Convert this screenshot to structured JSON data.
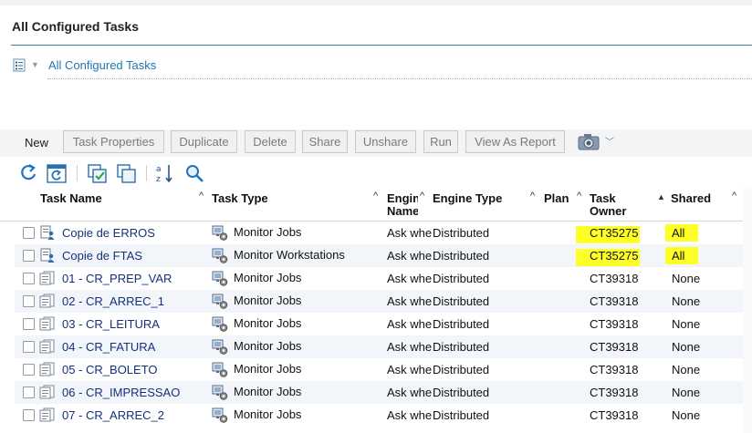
{
  "page": {
    "title": "All Configured Tasks"
  },
  "view": {
    "link": "All Configured Tasks"
  },
  "toolbar": {
    "new": "New",
    "buttons": [
      "Task Properties",
      "Duplicate",
      "Delete",
      "Share",
      "Unshare",
      "Run",
      "View As Report"
    ]
  },
  "columns": {
    "task_name": "Task Name",
    "task_type": "Task Type",
    "engine_name": "Engine Name",
    "engine_type": "Engine Type",
    "plan": "Plan",
    "task_owner": "Task Owner",
    "shared": "Shared"
  },
  "rows": [
    {
      "name": "Copie de ERROS",
      "type": "Monitor Jobs",
      "engine_name": "Ask when needed",
      "engine_type": "Distributed",
      "owner": "CT35275",
      "shared": "All",
      "highlight": true,
      "icon": "shared-task-icon"
    },
    {
      "name": "Copie de FTAS",
      "type": "Monitor Workstations",
      "engine_name": "Ask when needed",
      "engine_type": "Distributed",
      "owner": "CT35275",
      "shared": "All",
      "highlight": true,
      "icon": "shared-task-icon"
    },
    {
      "name": "01 - CR_PREP_VAR",
      "type": "Monitor Jobs",
      "engine_name": "Ask when needed",
      "engine_type": "Distributed",
      "owner": "CT39318",
      "shared": "None",
      "highlight": false,
      "icon": "task-icon"
    },
    {
      "name": "02 - CR_ARREC_1",
      "type": "Monitor Jobs",
      "engine_name": "Ask when needed",
      "engine_type": "Distributed",
      "owner": "CT39318",
      "shared": "None",
      "highlight": false,
      "icon": "task-icon"
    },
    {
      "name": "03 - CR_LEITURA",
      "type": "Monitor Jobs",
      "engine_name": "Ask when needed",
      "engine_type": "Distributed",
      "owner": "CT39318",
      "shared": "None",
      "highlight": false,
      "icon": "task-icon"
    },
    {
      "name": "04 - CR_FATURA",
      "type": "Monitor Jobs",
      "engine_name": "Ask when needed",
      "engine_type": "Distributed",
      "owner": "CT39318",
      "shared": "None",
      "highlight": false,
      "icon": "task-icon"
    },
    {
      "name": "05 - CR_BOLETO",
      "type": "Monitor Jobs",
      "engine_name": "Ask when needed",
      "engine_type": "Distributed",
      "owner": "CT39318",
      "shared": "None",
      "highlight": false,
      "icon": "task-icon"
    },
    {
      "name": "06 - CR_IMPRESSAO",
      "type": "Monitor Jobs",
      "engine_name": "Ask when needed",
      "engine_type": "Distributed",
      "owner": "CT39318",
      "shared": "None",
      "highlight": false,
      "icon": "task-icon"
    },
    {
      "name": "07 - CR_ARREC_2",
      "type": "Monitor Jobs",
      "engine_name": "Ask when needed",
      "engine_type": "Distributed",
      "owner": "CT39318",
      "shared": "None",
      "highlight": false,
      "icon": "task-icon"
    }
  ]
}
